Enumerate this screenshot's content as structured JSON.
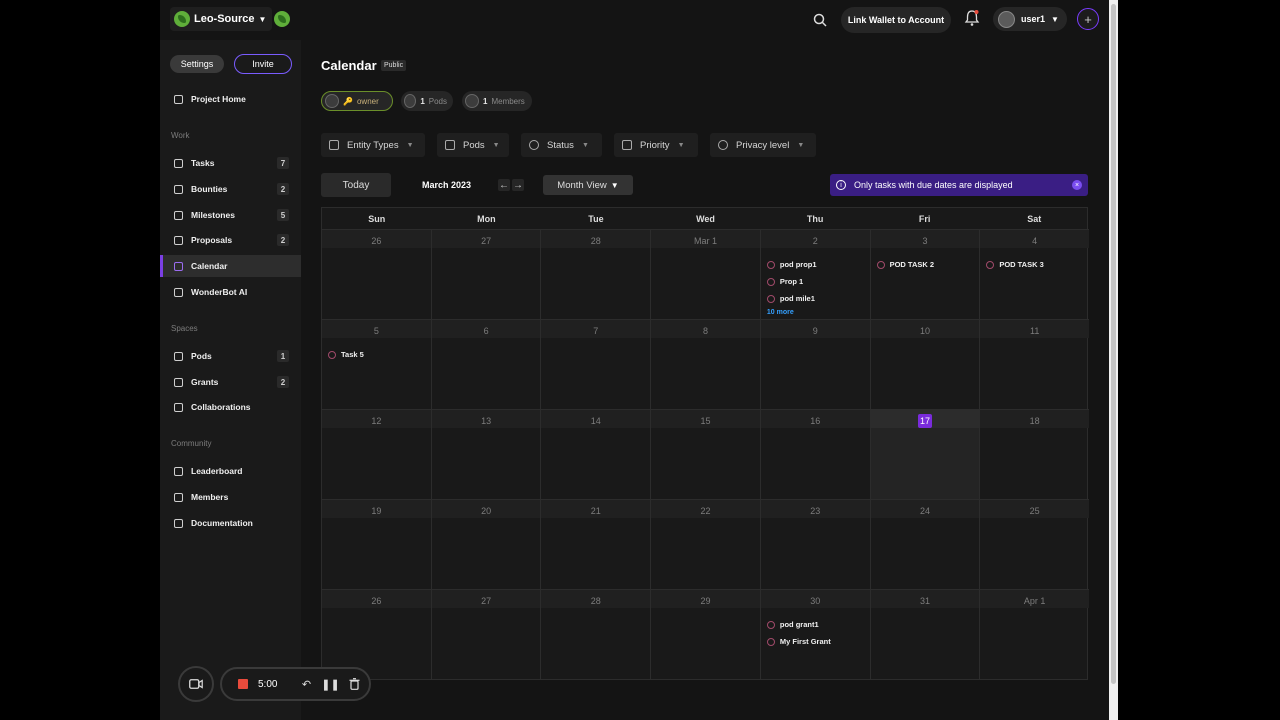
{
  "topbar": {
    "workspace_name": "Leo-Source",
    "wallet_button": "Link Wallet to Account",
    "username": "user1",
    "add_label": "+"
  },
  "sidebar": {
    "settings_label": "Settings",
    "invite_label": "Invite",
    "project_home": "Project Home",
    "sections": {
      "work": "Work",
      "spaces": "Spaces",
      "community": "Community"
    },
    "work_items": [
      {
        "label": "Tasks",
        "count": "7"
      },
      {
        "label": "Bounties",
        "count": "2"
      },
      {
        "label": "Milestones",
        "count": "5"
      },
      {
        "label": "Proposals",
        "count": "2"
      },
      {
        "label": "Calendar",
        "count": ""
      },
      {
        "label": "WonderBot AI",
        "count": ""
      }
    ],
    "space_items": [
      {
        "label": "Pods",
        "count": "1"
      },
      {
        "label": "Grants",
        "count": "2"
      },
      {
        "label": "Collaborations",
        "count": ""
      }
    ],
    "community_items": [
      {
        "label": "Leaderboard"
      },
      {
        "label": "Members"
      },
      {
        "label": "Documentation"
      }
    ]
  },
  "header": {
    "title": "Calendar",
    "badge": "Public",
    "owner_label": "owner",
    "pods_count": "1",
    "pods_label": "Pods",
    "members_count": "1",
    "members_label": "Members"
  },
  "filters": [
    "Entity Types",
    "Pods",
    "Status",
    "Priority",
    "Privacy level"
  ],
  "toolbar": {
    "today": "Today",
    "month": "March 2023",
    "prev": "←",
    "next": "→",
    "view": "Month View",
    "banner": "Only tasks with due dates are displayed",
    "banner_close": "×"
  },
  "calendar": {
    "weekdays": [
      "Sun",
      "Mon",
      "Tue",
      "Wed",
      "Thu",
      "Fri",
      "Sat"
    ],
    "weeks": [
      [
        "26",
        "27",
        "28",
        "Mar 1",
        "2",
        "3",
        "4"
      ],
      [
        "5",
        "6",
        "7",
        "8",
        "9",
        "10",
        "11"
      ],
      [
        "12",
        "13",
        "14",
        "15",
        "16",
        "17",
        "18"
      ],
      [
        "19",
        "20",
        "21",
        "22",
        "23",
        "24",
        "25"
      ],
      [
        "26",
        "27",
        "28",
        "29",
        "30",
        "31",
        "Apr 1"
      ]
    ],
    "today_label": "17",
    "events": {
      "w0_thu": [
        "pod prop1",
        "Prop 1",
        "pod mile1"
      ],
      "w0_thu_more": "10 more",
      "w0_fri": [
        "POD TASK 2"
      ],
      "w0_sat": [
        "POD TASK 3"
      ],
      "w1_sun": [
        "Task 5"
      ],
      "w4_thu": [
        "pod grant1",
        "My First Grant"
      ]
    }
  },
  "recorder": {
    "time": "5:00"
  },
  "colors": {
    "accent": "#7b3fe4",
    "banner": "#3a1e84",
    "link": "#34a0ff",
    "record": "#e94b3c"
  }
}
